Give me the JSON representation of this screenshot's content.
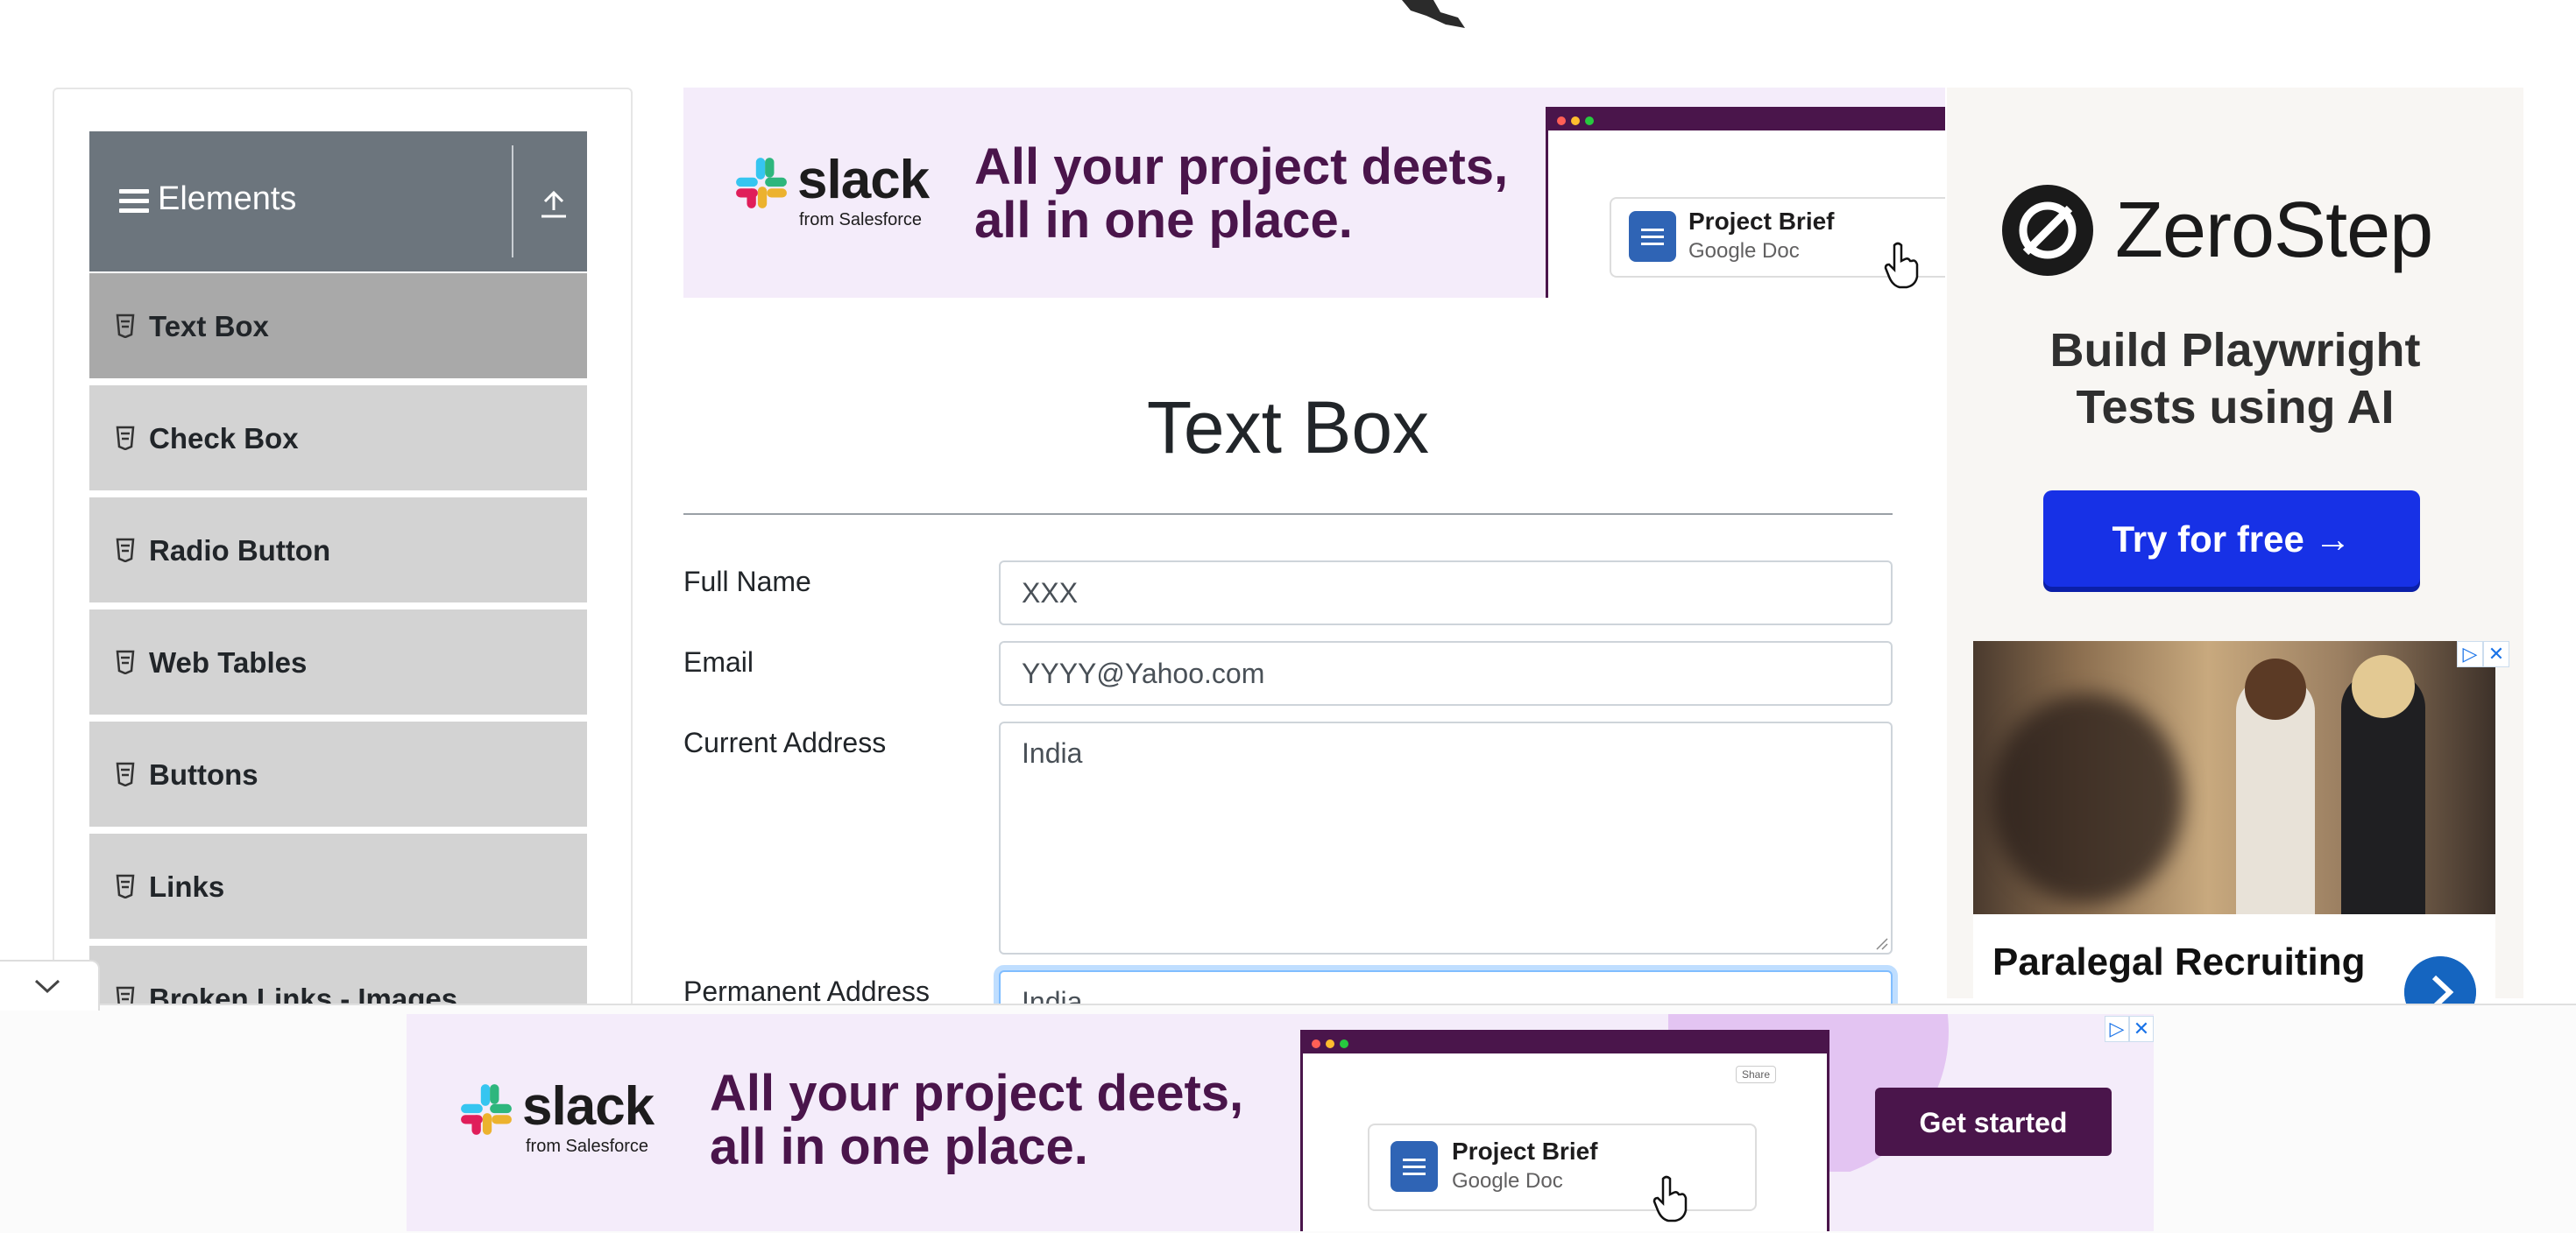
{
  "sidebar": {
    "group_title": "Elements",
    "items": [
      {
        "label": "Text Box",
        "active": true
      },
      {
        "label": "Check Box"
      },
      {
        "label": "Radio Button"
      },
      {
        "label": "Web Tables"
      },
      {
        "label": "Buttons"
      },
      {
        "label": "Links"
      },
      {
        "label": "Broken Links - Images"
      }
    ]
  },
  "top_ad": {
    "brand": "slack",
    "brand_sub": "from Salesforce",
    "headline_line1": "All your project deets,",
    "headline_line2": "all in one place.",
    "card_title": "Project Brief",
    "card_subtitle": "Google Doc"
  },
  "form": {
    "title": "Text Box",
    "full_name": {
      "label": "Full Name",
      "value": "XXX"
    },
    "email": {
      "label": "Email",
      "value": "YYYY@Yahoo.com"
    },
    "current_address": {
      "label": "Current Address",
      "value": "India"
    },
    "permanent_address": {
      "label": "Permanent Address",
      "value": "India"
    }
  },
  "side_ad": {
    "brand": "ZeroStep",
    "tagline_line1": "Build Playwright",
    "tagline_line2": "Tests using AI",
    "cta": "Try for free →",
    "photo_ad_title": "Paralegal Recruiting",
    "adchoices_label": "▷",
    "close_label": "✕"
  },
  "bottom_ad": {
    "brand": "slack",
    "brand_sub": "from Salesforce",
    "headline_line1": "All your project deets,",
    "headline_line2": "all in one place.",
    "card_title": "Project Brief",
    "card_subtitle": "Google Doc",
    "share_label": "Share",
    "cta": "Get started",
    "adchoices_label": "▷",
    "close_label": "✕"
  },
  "colors": {
    "sidebar_header": "#6c757d",
    "menu_item": "#d3d3d3",
    "menu_item_active": "#a9a9a9",
    "slack_purple": "#4a154b",
    "zerostep_button": "#1731e6"
  }
}
